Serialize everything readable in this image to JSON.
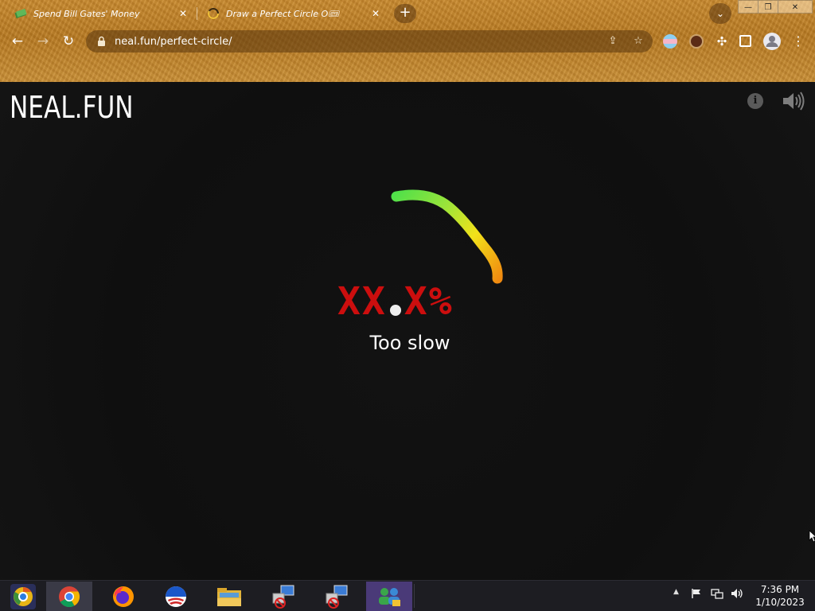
{
  "tabs": [
    {
      "title": "Spend Bill Gates' Money",
      "icon": "money-icon"
    },
    {
      "title": "Draw a Perfect Circle O🎟",
      "icon": "circle-site-icon"
    }
  ],
  "address_bar": {
    "url": "neal.fun/perfect-circle/"
  },
  "page": {
    "logo": "NEAL.FUN",
    "score_left": "XX",
    "score_right": "X%",
    "verdict": "Too slow"
  },
  "taskbar": {
    "apps": [
      "chrome-canary-icon",
      "chrome-icon",
      "firefox-icon",
      "opera-icon",
      "file-explorer-icon",
      "network-tool-icon",
      "network-tool-icon",
      "messenger-icon"
    ],
    "time": "7:36 PM",
    "date": "1/10/2023"
  },
  "colors": {
    "score": "#cc0e0e",
    "arc_start": "#4ee04a",
    "arc_mid": "#f2e21a",
    "arc_end": "#f08a10"
  }
}
